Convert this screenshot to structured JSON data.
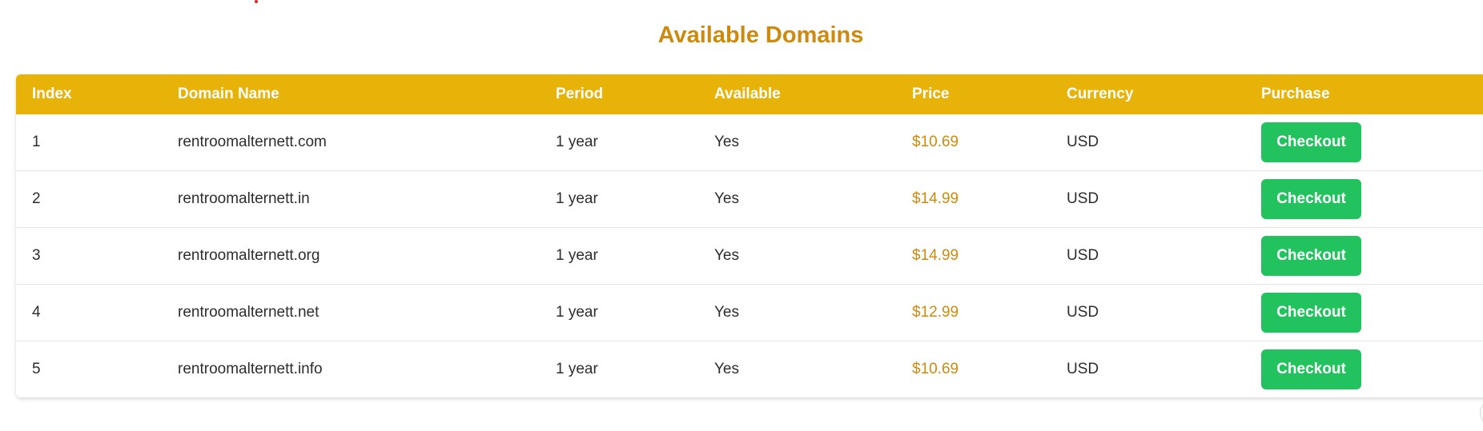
{
  "page": {
    "title": "Available Domains"
  },
  "table": {
    "headers": [
      "Index",
      "Domain Name",
      "Period",
      "Available",
      "Price",
      "Currency",
      "Purchase"
    ],
    "rows": [
      {
        "index": "1",
        "domain": "rentroomalternett.com",
        "period": "1 year",
        "available": "Yes",
        "price": "$10.69",
        "currency": "USD",
        "action": "Checkout"
      },
      {
        "index": "2",
        "domain": "rentroomalternett.in",
        "period": "1 year",
        "available": "Yes",
        "price": "$14.99",
        "currency": "USD",
        "action": "Checkout"
      },
      {
        "index": "3",
        "domain": "rentroomalternett.org",
        "period": "1 year",
        "available": "Yes",
        "price": "$14.99",
        "currency": "USD",
        "action": "Checkout"
      },
      {
        "index": "4",
        "domain": "rentroomalternett.net",
        "period": "1 year",
        "available": "Yes",
        "price": "$12.99",
        "currency": "USD",
        "action": "Checkout"
      },
      {
        "index": "5",
        "domain": "rentroomalternett.info",
        "period": "1 year",
        "available": "Yes",
        "price": "$10.69",
        "currency": "USD",
        "action": "Checkout"
      }
    ]
  },
  "colors": {
    "header_bg": "#e8b308",
    "title": "#cc8a0e",
    "price": "#cc8a0e",
    "button": "#22c35e"
  }
}
